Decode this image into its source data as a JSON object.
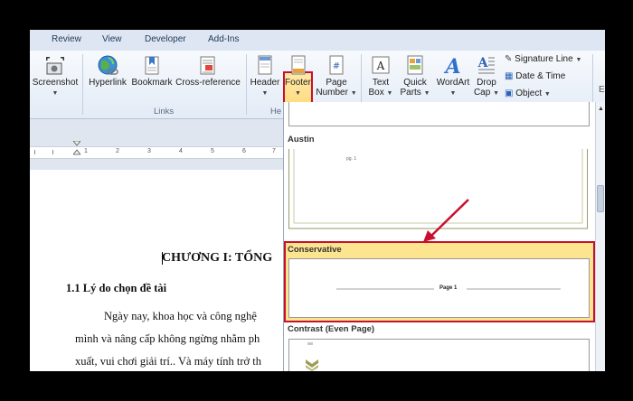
{
  "tabs": [
    "Review",
    "View",
    "Developer",
    "Add-Ins"
  ],
  "ribbon": {
    "screenshot": "Screenshot",
    "hyperlink": "Hyperlink",
    "bookmark": "Bookmark",
    "cross_reference": "Cross-reference",
    "links_group": "Links",
    "header": "Header",
    "header_group_partial": "He",
    "footer": "Footer",
    "page_number_line1": "Page",
    "page_number_line2": "Number",
    "text_box_line1": "Text",
    "text_box_line2": "Box",
    "quick_parts_line1": "Quick",
    "quick_parts_line2": "Parts",
    "wordart": "WordArt",
    "drop_cap_line1": "Drop",
    "drop_cap_line2": "Cap",
    "signature_line": "Signature Line",
    "date_time": "Date & Time",
    "object": "Object",
    "edge_partial": "E"
  },
  "ruler": {
    "numbers": [
      "1",
      "2",
      "3",
      "4",
      "5",
      "6",
      "7"
    ]
  },
  "document": {
    "title": "CHƯƠNG I: TỔNG",
    "heading": "1.1 Lý do chọn đề tài",
    "lines": [
      "Ngày nay, khoa học và công nghệ",
      "mình và nâng cấp không ngừng nhằm ph",
      "xuất, vui chơi giải trí.. Và máy tính trở th"
    ]
  },
  "gallery": {
    "items": [
      {
        "name": "Austin",
        "preview_text": "pg. 1"
      },
      {
        "name": "Conservative",
        "preview_text": "Page 1"
      },
      {
        "name": "Contrast (Even Page)",
        "preview_text": ""
      }
    ]
  },
  "colors": {
    "highlight_border": "#c8102e",
    "selected_fill": "#fde48f",
    "arrow": "#c8102e"
  }
}
